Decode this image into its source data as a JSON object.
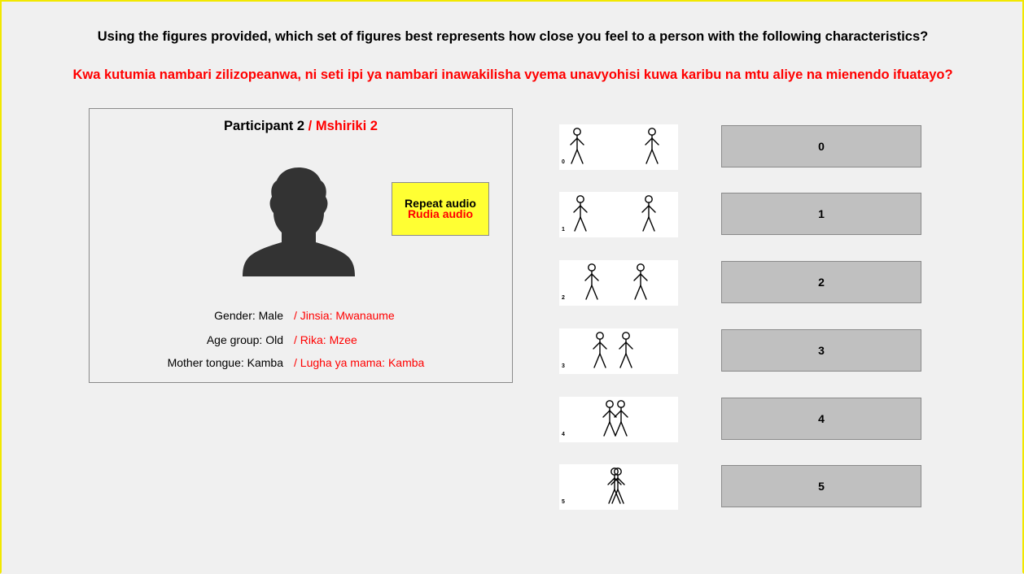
{
  "question": {
    "english": "Using the figures provided, which set of figures best represents how close you feel to a person with the following characteristics?",
    "swahili": "Kwa kutumia nambari zilizopeanwa, ni seti ipi ya nambari inawakilisha vyema unavyohisi kuwa karibu na mtu aliye na mienendo ifuatayo?"
  },
  "participant": {
    "title_en": "Participant 2",
    "title_sw": "/ Mshiriki 2",
    "avatar_icon": "person-silhouette-icon",
    "repeat_audio_en": "Repeat audio",
    "repeat_audio_sw": "Rudia audio",
    "attributes": [
      {
        "en": "Gender: Male",
        "sw": "/ Jinsia: Mwanaume"
      },
      {
        "en": "Age group: Old",
        "sw": "/ Rika: Mzee"
      },
      {
        "en": "Mother tongue: Kamba",
        "sw": "/ Lugha ya mama: Kamba"
      }
    ]
  },
  "figures": [
    {
      "label": "0",
      "icon": "two-stick-figures-icon"
    },
    {
      "label": "1",
      "icon": "two-stick-figures-icon"
    },
    {
      "label": "2",
      "icon": "two-stick-figures-icon"
    },
    {
      "label": "3",
      "icon": "two-stick-figures-icon"
    },
    {
      "label": "4",
      "icon": "two-stick-figures-icon"
    },
    {
      "label": "5",
      "icon": "two-stick-figures-icon"
    }
  ],
  "options": [
    "0",
    "1",
    "2",
    "3",
    "4",
    "5"
  ],
  "colors": {
    "background": "#f0f0f0",
    "accent_yellow": "#ffff33",
    "swahili_red": "#ff0000",
    "option_gray": "#c0c0c0"
  }
}
